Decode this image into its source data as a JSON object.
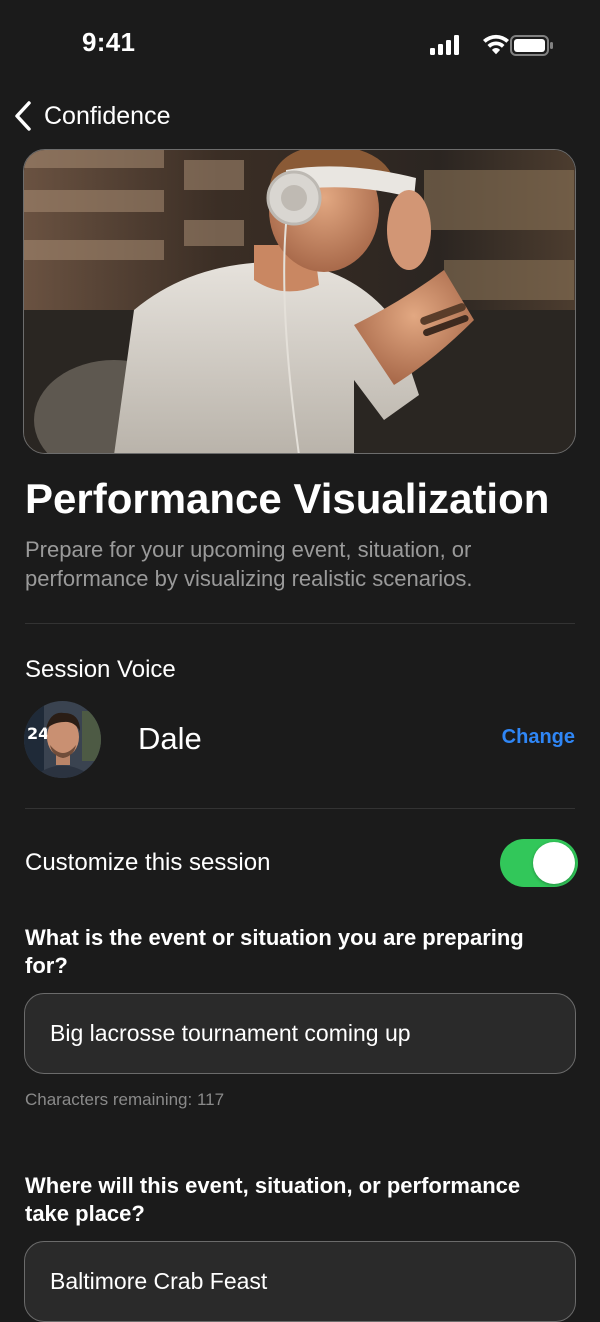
{
  "status_bar": {
    "time": "9:41",
    "icons": [
      "cellular-signal-icon",
      "wifi-icon",
      "battery-icon"
    ]
  },
  "nav": {
    "back_label": "Confidence",
    "back_icon": "chevron-left-icon"
  },
  "hero": {
    "image": "athlete-with-headphones-photo"
  },
  "header": {
    "title": "Performance Visualization",
    "subtitle": "Prepare for your upcoming event, situation, or performance by visualizing realistic scenarios."
  },
  "voice": {
    "section_label": "Session Voice",
    "name": "Dale",
    "change_label": "Change"
  },
  "customize": {
    "label": "Customize this session",
    "enabled": true
  },
  "form": {
    "q1": {
      "label": "What is the event or situation you are preparing for?",
      "value": "Big lacrosse tournament coming up",
      "char_count": "Characters remaining: 117"
    },
    "q2": {
      "label": "Where will this event, situation, or performance take place?",
      "value": "Baltimore Crab Feast"
    }
  },
  "colors": {
    "background": "#1b1b1b",
    "accent_link": "#2f86f5",
    "toggle_on": "#32c75a",
    "secondary_text": "#9a9a9a"
  }
}
